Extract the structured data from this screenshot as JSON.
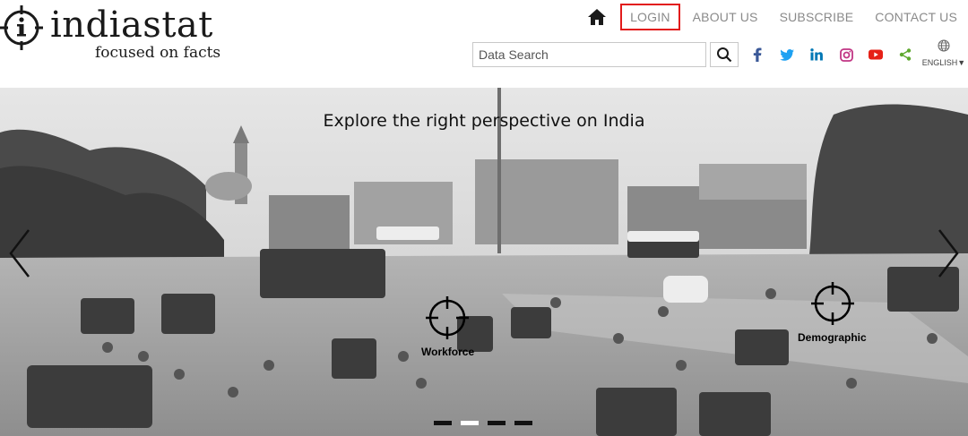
{
  "brand": {
    "name": "indiastat",
    "tagline": "focused on facts"
  },
  "nav": {
    "items": [
      {
        "label": "LOGIN",
        "active": true
      },
      {
        "label": "ABOUT US"
      },
      {
        "label": "SUBSCRIBE"
      },
      {
        "label": "CONTACT US"
      }
    ],
    "home_icon": "home-icon"
  },
  "search": {
    "placeholder": "Data Search",
    "value": ""
  },
  "social": [
    "facebook-icon",
    "twitter-icon",
    "linkedin-icon",
    "instagram-icon",
    "youtube-icon",
    "share-icon"
  ],
  "language": {
    "label": "ENGLISH▼",
    "icon": "globe-icon"
  },
  "hero": {
    "title": "Explore the right perspective on India",
    "hotspots": [
      {
        "label": "Workforce"
      },
      {
        "label": "Demographic"
      }
    ],
    "slide_count": 4,
    "active_slide": 2
  },
  "colors": {
    "highlight_border": "#e21b1b",
    "nav_text": "#8a8a8a",
    "facebook": "#3b5998",
    "twitter": "#1da1f2",
    "linkedin": "#0077b5",
    "instagram": "#c13584",
    "youtube": "#e62117",
    "share": "#5fa82f"
  }
}
